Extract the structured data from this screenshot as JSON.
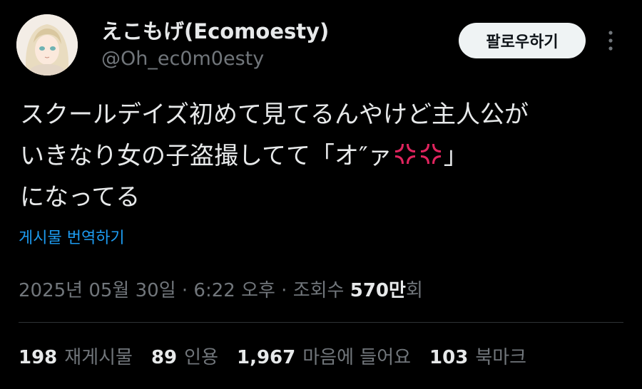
{
  "author": {
    "display_name": "えこもげ(Ecomoesty)",
    "handle": "@Oh_ec0m0esty"
  },
  "follow_button_label": "팔로우하기",
  "tweet": {
    "line1": "スクールデイズ初めて見てるんやけど主人公が",
    "line2_prefix": "いきなり女の子盗撮してて「オ″ァ",
    "line2_suffix": "」",
    "line3": "になってる",
    "emoji": "anger-symbol-icon"
  },
  "translate_label": "게시물 번역하기",
  "meta": {
    "timestamp": "2025년 05월 30일 · 6:22 오후",
    "separator": " · ",
    "views_prefix": "조회수 ",
    "views_number": "570",
    "views_unit": "만",
    "views_suffix": "회"
  },
  "stats": [
    {
      "number": "198",
      "label": "재게시물"
    },
    {
      "number": "89",
      "label": "인용"
    },
    {
      "number": "1,967",
      "label": "마음에 들어요"
    },
    {
      "number": "103",
      "label": "북마크"
    }
  ],
  "colors": {
    "background": "#000000",
    "text": "#e7e9ea",
    "muted": "#71767b",
    "link": "#1d9bf0",
    "anger": "#e0245e"
  }
}
